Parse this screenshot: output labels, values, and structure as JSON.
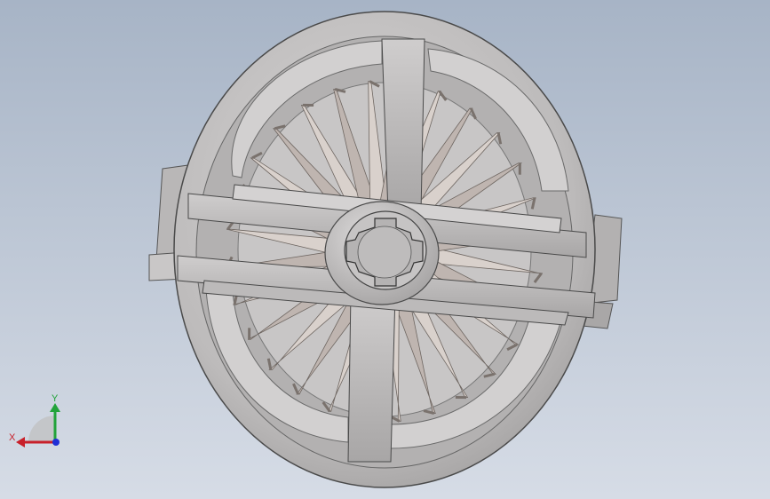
{
  "viewport": {
    "background_top": "#a7b4c6",
    "background_bottom": "#d6dce6"
  },
  "model": {
    "name": "impeller-wheel",
    "blade_count": 28,
    "body_color": "#c4c2c2",
    "shadow_color": "#8f8d8d",
    "blade_color": "#cbc1bc",
    "edge_color": "#4a4a4a"
  },
  "triad": {
    "x_label": "X",
    "y_label": "Y",
    "x_color": "#c8202a",
    "y_color": "#22a33a",
    "z_color": "#1f2fd6"
  }
}
